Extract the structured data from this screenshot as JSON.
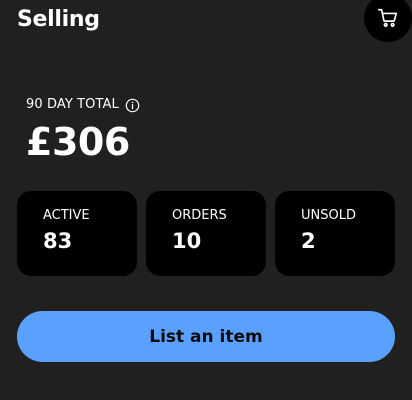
{
  "header": {
    "title": "Selling",
    "cart_icon": "cart-icon"
  },
  "summary": {
    "label": "90 DAY TOTAL",
    "info_icon": "info-icon",
    "amount": "£306"
  },
  "stats": [
    {
      "label": "ACTIVE",
      "value": "83"
    },
    {
      "label": "ORDERS",
      "value": "10"
    },
    {
      "label": "UNSOLD",
      "value": "2"
    }
  ],
  "actions": {
    "list_item_label": "List an item"
  },
  "colors": {
    "background": "#202020",
    "card": "#000000",
    "accent": "#5aa0ff",
    "text": "#ffffff"
  }
}
